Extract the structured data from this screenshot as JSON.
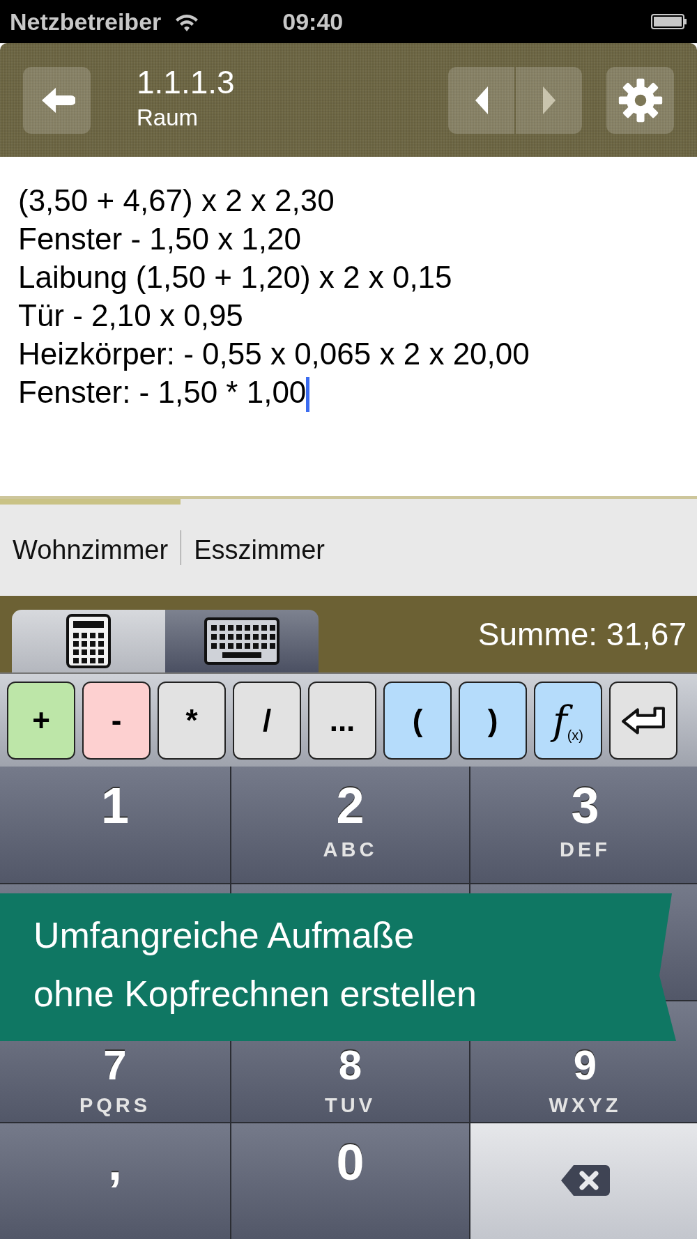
{
  "status_bar": {
    "carrier": "Netzbetreiber",
    "time": "09:40"
  },
  "header": {
    "title": "1.1.1.3",
    "subtitle": "Raum"
  },
  "editor": {
    "lines": [
      "(3,50 + 4,67) x 2 x 2,30",
      "Fenster - 1,50 x 1,20",
      "Laibung (1,50 + 1,20) x 2 x 0,15",
      "Tür - 2,10 x 0,95",
      "Heizkörper: - 0,55 x 0,065 x 2 x 20,00",
      "Fenster: - 1,50 * 1,00"
    ]
  },
  "tabs": [
    {
      "label": "Wohnzimmer",
      "selected": true
    },
    {
      "label": "Esszimmer",
      "selected": false
    }
  ],
  "input_modes": [
    {
      "kind": "calculator",
      "selected": true
    },
    {
      "kind": "keyboard",
      "selected": false
    }
  ],
  "sum": "Summe: 31,67",
  "operator_keys": [
    {
      "kind": "text",
      "label": "+",
      "color": "#bde6a8"
    },
    {
      "kind": "text",
      "label": "-",
      "color": "#fdd0d0"
    },
    {
      "kind": "text",
      "label": "*",
      "color": "#e2e2e2"
    },
    {
      "kind": "text",
      "label": "/",
      "color": "#e2e2e2"
    },
    {
      "kind": "text",
      "label": "...",
      "color": "#e2e2e2"
    },
    {
      "kind": "text",
      "label": "(",
      "color": "#b5dcfb"
    },
    {
      "kind": "text",
      "label": ")",
      "color": "#b5dcfb"
    },
    {
      "kind": "function",
      "label": "f",
      "sub": "(x)",
      "color": "#b5dcfb"
    },
    {
      "kind": "return",
      "color": "#e2e2e2"
    }
  ],
  "keypad": [
    {
      "kind": "digit",
      "digit": "1"
    },
    {
      "kind": "digit",
      "digit": "2",
      "letters": "ABC"
    },
    {
      "kind": "digit",
      "digit": "3",
      "letters": "DEF"
    },
    {
      "kind": "covered"
    },
    {
      "kind": "covered"
    },
    {
      "kind": "covered"
    },
    {
      "kind": "digit",
      "digit": "7",
      "letters": "PQRS"
    },
    {
      "kind": "digit",
      "digit": "8",
      "letters": "TUV"
    },
    {
      "kind": "digit",
      "digit": "9",
      "letters": "WXYZ"
    },
    {
      "kind": "comma",
      "digit": ","
    },
    {
      "kind": "digit",
      "digit": "0"
    },
    {
      "kind": "delete"
    }
  ],
  "banner": {
    "lines": [
      "Umfangreiche Aufmaße",
      "ohne Kopfrechnen erstellen"
    ]
  }
}
